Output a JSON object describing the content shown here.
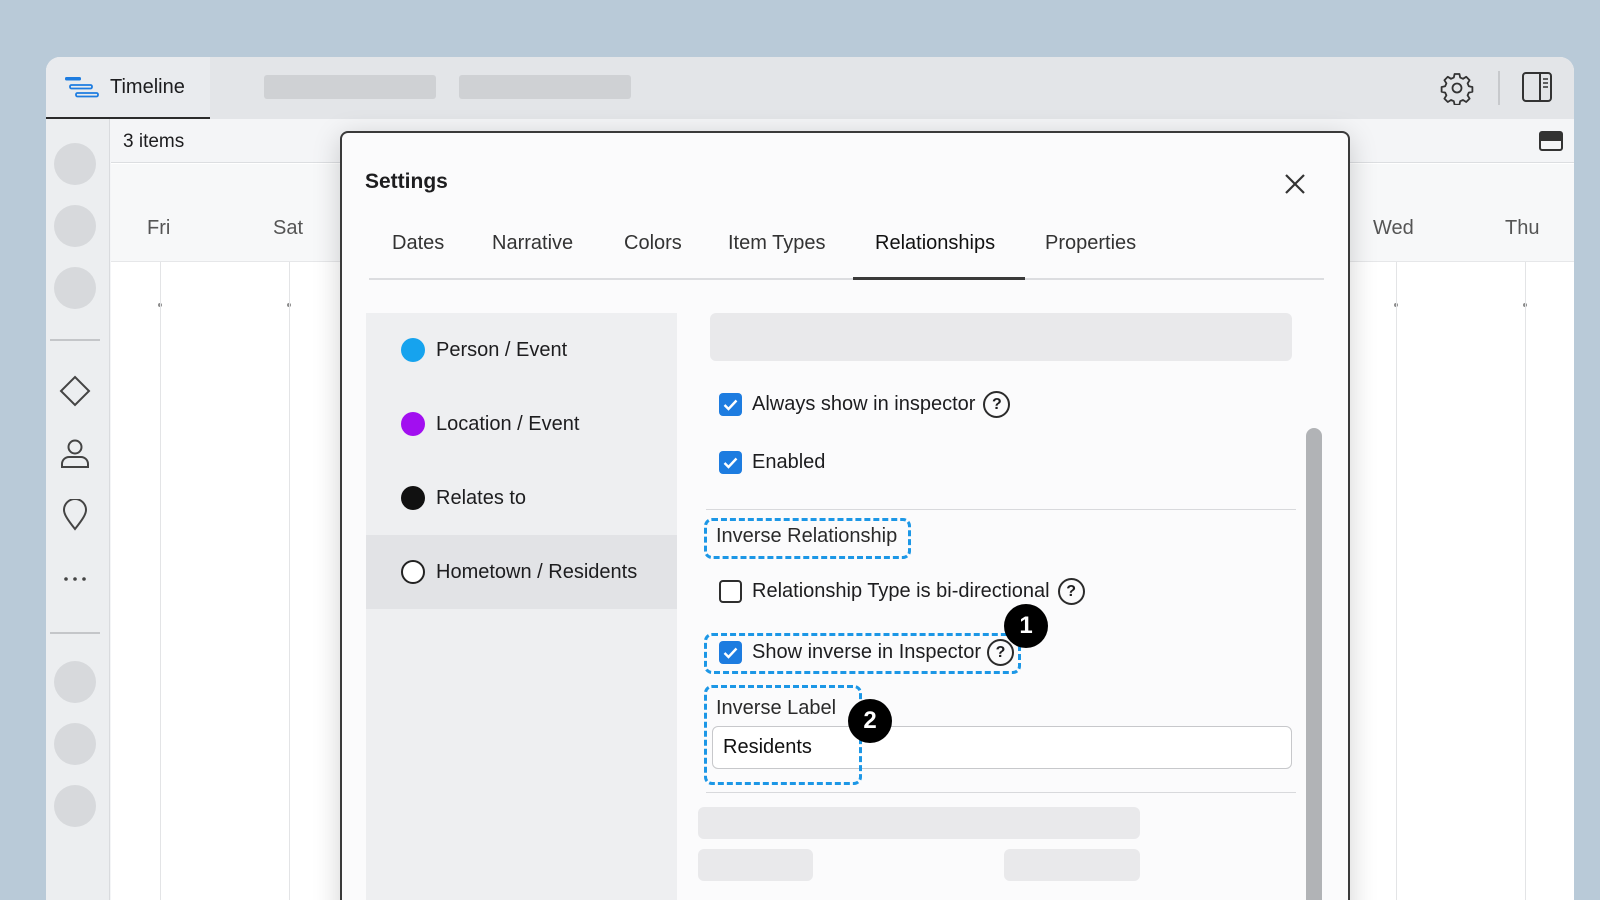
{
  "topbar": {
    "tab_label": "Timeline"
  },
  "itembar": {
    "count": "3 items"
  },
  "days": [
    "Fri",
    "Sat",
    "Wed",
    "Thu"
  ],
  "settings": {
    "title": "Settings",
    "tabs": [
      "Dates",
      "Narrative",
      "Colors",
      "Item Types",
      "Relationships",
      "Properties"
    ],
    "active_tab": "Relationships",
    "relationships": [
      {
        "label": "Person / Event",
        "color": "#16a3ee"
      },
      {
        "label": "Location / Event",
        "color": "#a20ff0"
      },
      {
        "label": "Relates to",
        "color": "#111111"
      },
      {
        "label": "Hometown / Residents",
        "color": "outline"
      }
    ],
    "form": {
      "always_show": "Always show in inspector",
      "enabled": "Enabled",
      "inverse_section": "Inverse Relationship",
      "bidirectional": "Relationship Type is bi-directional",
      "show_inverse": "Show inverse in Inspector",
      "inverse_label": "Inverse Label",
      "inverse_value": "Residents",
      "help": "?"
    },
    "badges": [
      "1",
      "2"
    ]
  },
  "colors": {
    "accent": "#1d7ce0",
    "highlight": "#1c97e6"
  }
}
